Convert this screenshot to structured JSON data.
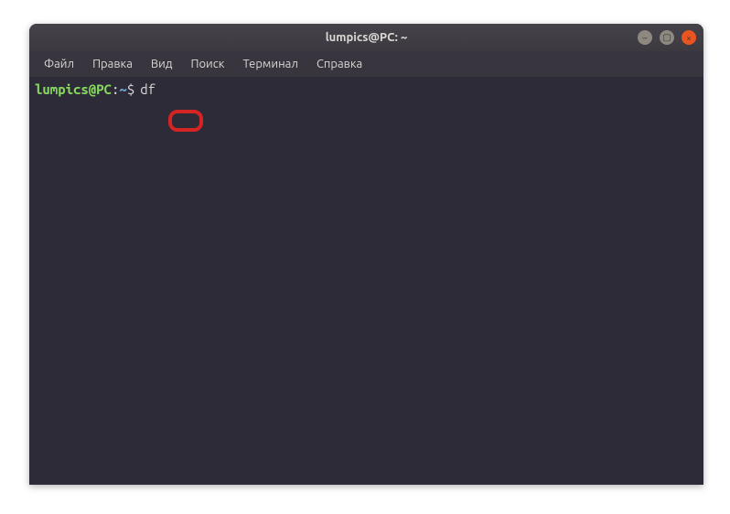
{
  "window": {
    "title": "lumpics@PC: ~"
  },
  "menu": {
    "items": [
      {
        "label": "Файл"
      },
      {
        "label": "Правка"
      },
      {
        "label": "Вид"
      },
      {
        "label": "Поиск"
      },
      {
        "label": "Терминал"
      },
      {
        "label": "Справка"
      }
    ]
  },
  "prompt": {
    "user_host": "lumpics@PC",
    "colon": ":",
    "path": "~",
    "symbol": "$"
  },
  "command": "df",
  "controls": {
    "min_glyph": "–",
    "max_glyph": "▢",
    "close_glyph": "×"
  }
}
